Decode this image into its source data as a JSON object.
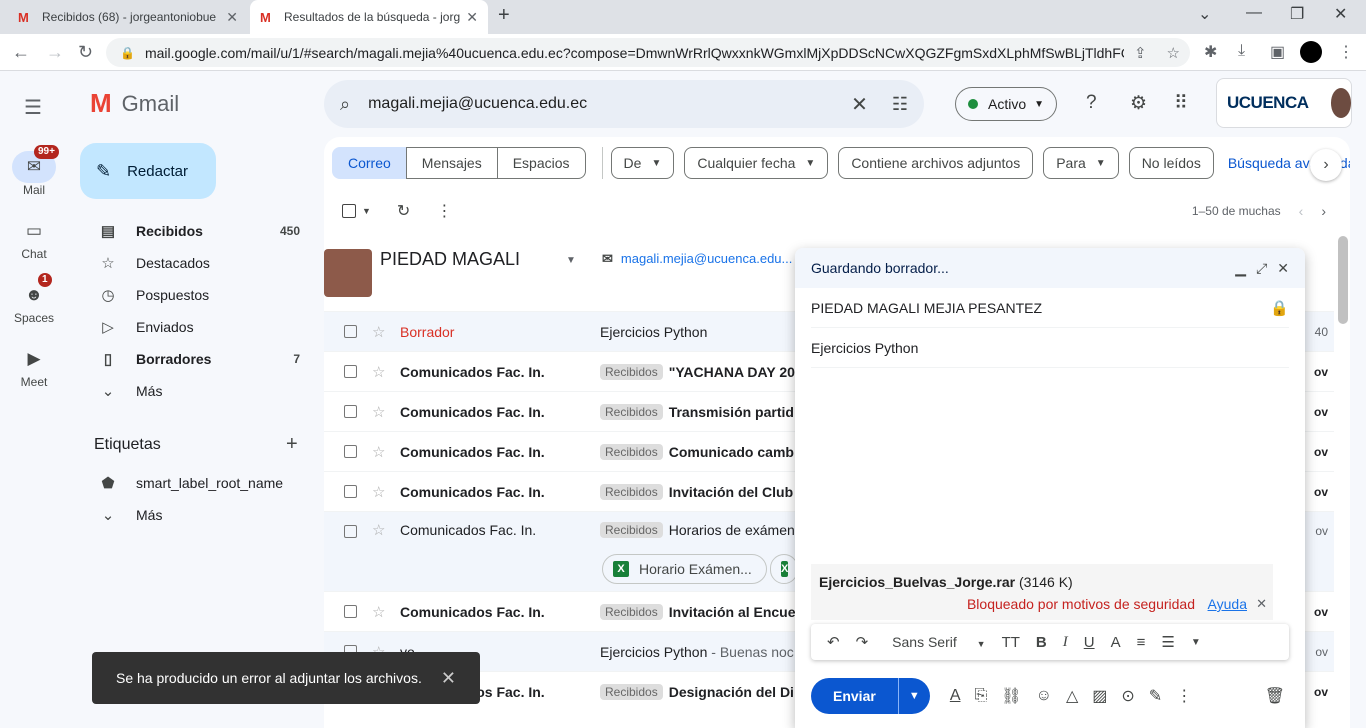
{
  "browser": {
    "tabs": [
      {
        "title": "Recibidos (68) - jorgeantoniobue",
        "icon": "gmail-icon"
      },
      {
        "title": "Resultados de la búsqueda - jorg",
        "icon": "gmail-icon"
      }
    ],
    "url": "mail.google.com/mail/u/1/#search/magali.mejia%40ucuenca.edu.ec?compose=DmwnWrRrlQwxxnkWGmxlMjXpDDScNCwXQGZFgmSxdXLphMfSwBLjTldhFC..."
  },
  "rail": {
    "mail_label": "Mail",
    "mail_badge": "99+",
    "chat_label": "Chat",
    "spaces_label": "Spaces",
    "spaces_badge": "1",
    "meet_label": "Meet"
  },
  "app": {
    "name": "Gmail"
  },
  "compose_button": "Redactar",
  "sidebar": {
    "items": [
      {
        "label": "Recibidos",
        "count": "450",
        "icon": "inbox-icon"
      },
      {
        "label": "Destacados",
        "count": "",
        "icon": "star-icon"
      },
      {
        "label": "Pospuestos",
        "count": "",
        "icon": "clock-icon"
      },
      {
        "label": "Enviados",
        "count": "",
        "icon": "send-icon"
      },
      {
        "label": "Borradores",
        "count": "7",
        "icon": "draft-icon"
      },
      {
        "label": "Más",
        "count": "",
        "icon": "chevron-down-icon"
      }
    ],
    "labels_heading": "Etiquetas",
    "labels": [
      {
        "label": "smart_label_root_name",
        "icon": "label-icon"
      },
      {
        "label": "Más",
        "icon": "chevron-down-icon"
      }
    ]
  },
  "search": {
    "query": "magali.mejia@ucuenca.edu.ec"
  },
  "status": {
    "label": "Activo"
  },
  "account": {
    "org": "UCUENCA"
  },
  "filters": {
    "segments": [
      "Correo",
      "Mensajes",
      "Espacios"
    ],
    "chips": [
      "De",
      "Cualquier fecha",
      "Contiene archivos adjuntos",
      "Para",
      "No leídos"
    ],
    "advanced": "Búsqueda avanzada"
  },
  "pager": {
    "text": "1–50 de muchas"
  },
  "contact": {
    "name": "PIEDAD MAGALI",
    "email": "magali.mejia@ucuenca.edu..."
  },
  "emails": [
    {
      "sender": "Borrador",
      "label": "",
      "subject": "Ejercicios Python",
      "snippet": "",
      "date": "40",
      "unread": false,
      "draft": true
    },
    {
      "sender": "Comunicados Fac. In.",
      "label": "Recibidos",
      "subject": "\"YACHANA DAY 20",
      "snippet": "",
      "date": "ov",
      "unread": true
    },
    {
      "sender": "Comunicados Fac. In.",
      "label": "Recibidos",
      "subject": "Transmisión partid",
      "snippet": "",
      "date": "ov",
      "unread": true
    },
    {
      "sender": "Comunicados Fac. In.",
      "label": "Recibidos",
      "subject": "Comunicado camb",
      "snippet": "",
      "date": "ov",
      "unread": true
    },
    {
      "sender": "Comunicados Fac. In.",
      "label": "Recibidos",
      "subject": "Invitación del Club",
      "snippet": "",
      "date": "ov",
      "unread": true
    },
    {
      "sender": "Comunicados Fac. In.",
      "label": "Recibidos",
      "subject": "Horarios de exámene",
      "snippet": "",
      "date": "ov",
      "unread": false,
      "attachment": "Horario Exámen..."
    },
    {
      "sender": "Comunicados Fac. In.",
      "label": "Recibidos",
      "subject": "Invitación al Encue",
      "snippet": "",
      "date": "ov",
      "unread": true
    },
    {
      "sender": "yo",
      "label": "",
      "subject": "Ejercicios Python",
      "snippet": "- Buenas noc",
      "date": "ov",
      "unread": false
    },
    {
      "sender": "Comunicados Fac. In.",
      "label": "Recibidos",
      "subject": "Designación del Di",
      "snippet": "",
      "date": "ov",
      "unread": true
    }
  ],
  "compose": {
    "title": "Guardando borrador...",
    "to": "PIEDAD MAGALI MEJIA PESANTEZ",
    "subject": "Ejercicios Python",
    "attachment_name": "Ejercicios_Buelvas_Jorge.rar",
    "attachment_size": "(3146 K)",
    "blocked": "Bloqueado por motivos de seguridad",
    "help": "Ayuda",
    "font": "Sans Serif",
    "send": "Enviar"
  },
  "snackbar": {
    "message": "Se ha producido un error al adjuntar los archivos."
  }
}
